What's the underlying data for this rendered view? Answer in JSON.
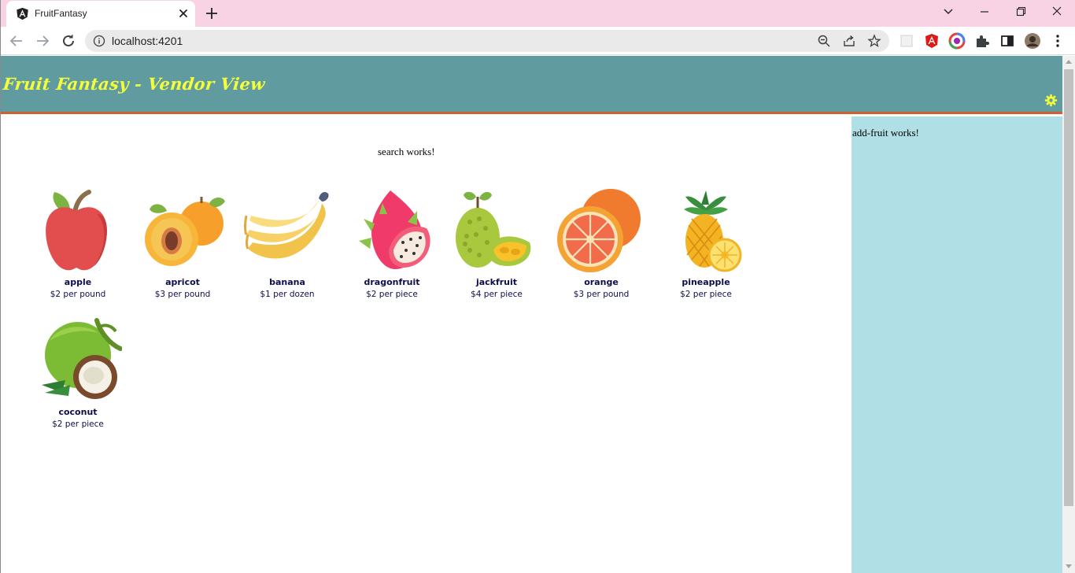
{
  "browser": {
    "tab_title": "FruitFantasy",
    "url": "localhost:4201"
  },
  "header": {
    "title": "Fruit Fantasy - Vendor View"
  },
  "search": {
    "message": "search works!"
  },
  "add_fruit": {
    "message": "add-fruit works!"
  },
  "fruits": [
    {
      "name": "apple",
      "price": "$2 per pound",
      "icon": "apple-icon"
    },
    {
      "name": "apricot",
      "price": "$3 per pound",
      "icon": "apricot-icon"
    },
    {
      "name": "banana",
      "price": "$1 per dozen",
      "icon": "banana-icon"
    },
    {
      "name": "dragonfruit",
      "price": "$2 per piece",
      "icon": "dragonfruit-icon"
    },
    {
      "name": "jackfruit",
      "price": "$4 per piece",
      "icon": "jackfruit-icon"
    },
    {
      "name": "orange",
      "price": "$3 per pound",
      "icon": "orange-icon"
    },
    {
      "name": "pineapple",
      "price": "$2 per piece",
      "icon": "pineapple-icon"
    },
    {
      "name": "coconut",
      "price": "$2 per piece",
      "icon": "coconut-icon"
    }
  ],
  "colors": {
    "header_bg": "#609c9f",
    "header_border": "#d2602e",
    "title": "#f5ff3b",
    "side_panel": "#b0dfe5",
    "fruit_text": "#0d0d4a",
    "tab_strip": "#f7d3e3"
  }
}
